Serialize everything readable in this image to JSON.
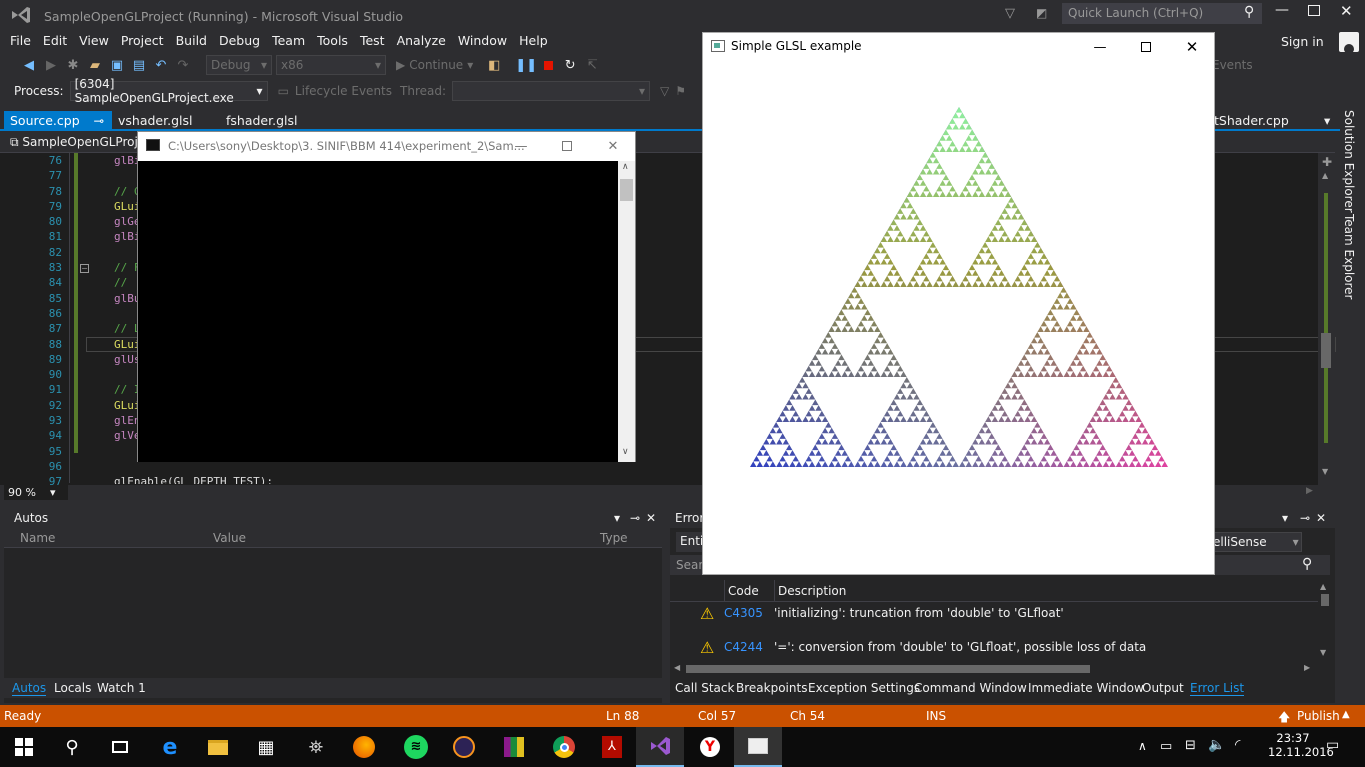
{
  "window": {
    "title": "SampleOpenGLProject (Running) - Microsoft Visual Studio"
  },
  "quick_launch": {
    "placeholder": "Quick Launch (Ctrl+Q)"
  },
  "menu": [
    "File",
    "Edit",
    "View",
    "Project",
    "Build",
    "Debug",
    "Team",
    "Tools",
    "Test",
    "Analyze",
    "Window",
    "Help"
  ],
  "signin": "Sign in",
  "toolbar": {
    "config": "Debug",
    "platform": "x86",
    "continue": "Continue",
    "events": "Events"
  },
  "process": {
    "label": "Process:",
    "value": "[6304] SampleOpenGLProject.exe",
    "lifecycle": "Lifecycle Events",
    "thread": "Thread:"
  },
  "tabs": {
    "source": "Source.cpp",
    "vshader": "vshader.glsl",
    "fshader": "fshader.glsl",
    "right": "tShader.cpp"
  },
  "editor": {
    "project": "SampleOpenGLProje",
    "lines": [
      "76",
      "77",
      "78",
      "79",
      "80",
      "81",
      "82",
      "83",
      "84",
      "85",
      "86",
      "87",
      "88",
      "89",
      "90",
      "91",
      "92",
      "93",
      "94",
      "95",
      "96",
      "97"
    ],
    "code": [
      "glBi",
      "",
      "// C",
      "GLui",
      "glGe",
      "glBi",
      "",
      "// F",
      "//",
      "glBu",
      "",
      "// L",
      "GLui",
      "glUs",
      "",
      "// I",
      "GLui",
      "glEn",
      "glVe",
      "",
      "",
      "glEnable(GL_DEPTH_TEST);"
    ],
    "zoom": "90 %"
  },
  "side_tabs": {
    "solution": "Solution Explorer",
    "team": "Team Explorer"
  },
  "console": {
    "title": "C:\\Users\\sony\\Desktop\\3. SINIF\\BBM 414\\experiment_2\\Sam..."
  },
  "gl_window": {
    "title": "Simple GLSL example"
  },
  "autos": {
    "title": "Autos",
    "columns": [
      "Name",
      "Value",
      "Type"
    ],
    "tabs": [
      "Autos",
      "Locals",
      "Watch 1"
    ]
  },
  "errors": {
    "title": "Error",
    "filter": "Enti",
    "intellisense": "elliSense",
    "search": "Searc",
    "columns": [
      "Code",
      "Description"
    ],
    "rows": [
      {
        "code": "C4305",
        "desc": "'initializing': truncation from 'double' to 'GLfloat'"
      },
      {
        "code": "C4244",
        "desc": "'=': conversion from 'double' to 'GLfloat', possible loss of data"
      }
    ],
    "tabs": [
      "Call Stack",
      "Breakpoints",
      "Exception Settings",
      "Command Window",
      "Immediate Window",
      "Output",
      "Error List"
    ]
  },
  "status": {
    "state": "Ready",
    "ln": "Ln 88",
    "col": "Col 57",
    "ch": "Ch 54",
    "ins": "INS",
    "publish": "Publish"
  },
  "clock": {
    "time": "23:37",
    "date": "12.11.2016"
  },
  "colors": {
    "accent": "#007acc",
    "status": "#ca5100",
    "bg": "#2d2d30",
    "editor": "#1e1e1e"
  }
}
